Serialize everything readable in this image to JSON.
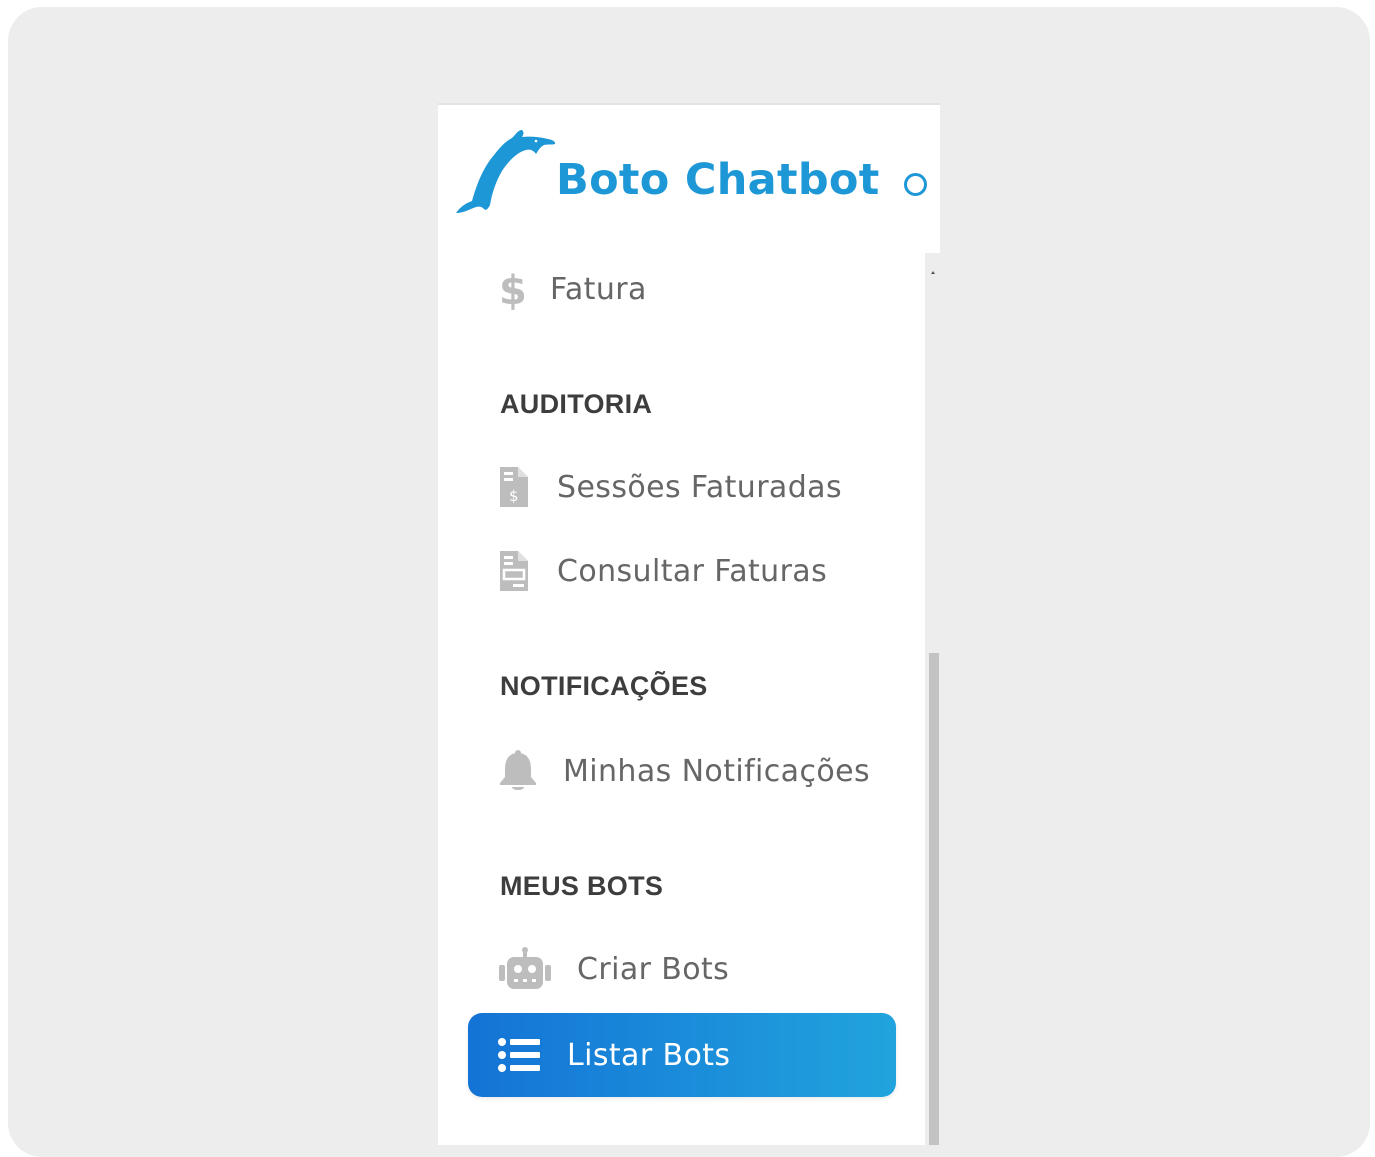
{
  "colors": {
    "brand": "#1e97d6",
    "active_gradient_start": "#1473d6",
    "active_gradient_end": "#21a4dd",
    "menu_text": "#666666",
    "section_text": "#3d3d3d",
    "icon_gray": "#bdbdbd"
  },
  "brand": {
    "name": "Boto Chatbot",
    "logo_icon": "dolphin-icon",
    "toggle_icon": "circle-icon"
  },
  "menu": {
    "fatura": {
      "label": "Fatura",
      "icon": "dollar-icon"
    },
    "sections": {
      "auditoria": {
        "title": "AUDITORIA",
        "items": [
          {
            "label": "Sessões Faturadas",
            "icon": "invoice-dollar-icon"
          },
          {
            "label": "Consultar Faturas",
            "icon": "invoice-list-icon"
          }
        ]
      },
      "notificacoes": {
        "title": "NOTIFICAÇÕES",
        "items": [
          {
            "label": "Minhas Notificações",
            "icon": "bell-icon"
          }
        ]
      },
      "meus_bots": {
        "title": "MEUS BOTS",
        "items": [
          {
            "label": "Criar Bots",
            "icon": "robot-icon"
          },
          {
            "label": "Listar Bots",
            "icon": "list-icon",
            "active": true
          }
        ]
      }
    }
  }
}
